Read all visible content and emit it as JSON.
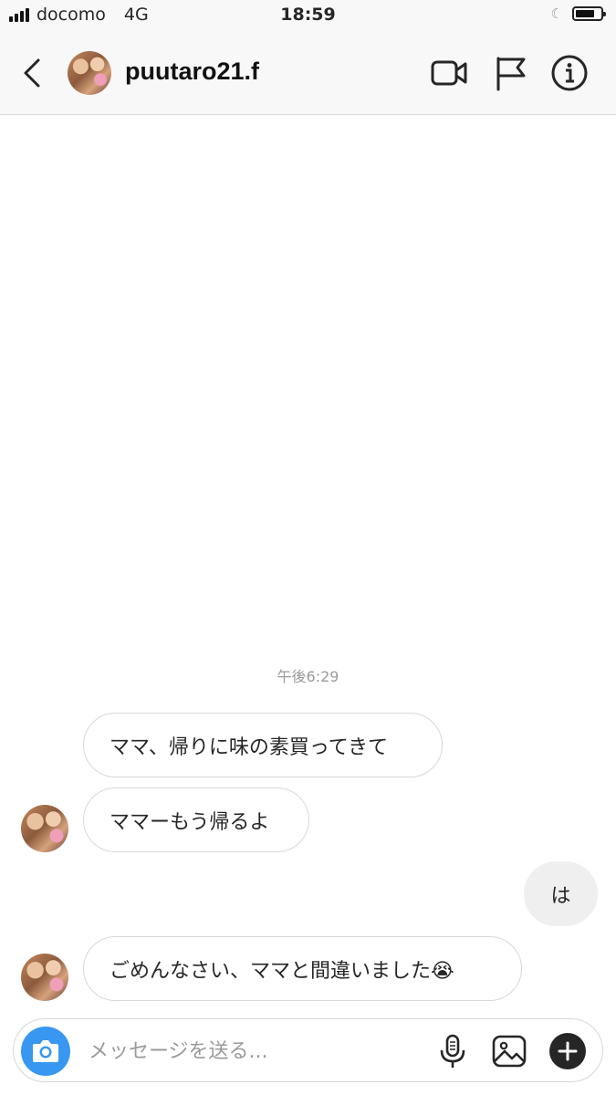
{
  "status_bar": {
    "carrier": "docomo",
    "network": "4G",
    "time": "18:59"
  },
  "header": {
    "username": "puutaro21.f",
    "icons": [
      "back-chevron-icon",
      "video-call-icon",
      "flag-icon",
      "info-icon"
    ]
  },
  "conversation": {
    "timestamp": "午後6:29",
    "messages": [
      {
        "sender": "other",
        "text": "ママ、帰りに味の素買ってきて",
        "show_avatar": false
      },
      {
        "sender": "other",
        "text": "ママーもう帰るよ",
        "show_avatar": true
      },
      {
        "sender": "me",
        "text": "は",
        "show_avatar": false
      },
      {
        "sender": "other",
        "text": "ごめんなさい、ママと間違いました😭",
        "show_avatar": true
      }
    ]
  },
  "composer": {
    "placeholder": "メッセージを送る...",
    "icons": [
      "camera-icon",
      "microphone-icon",
      "gallery-icon",
      "plus-icon"
    ]
  },
  "colors": {
    "accent": "#3897f0",
    "bubble_border": "#d8d8d8",
    "my_bubble": "#efefef",
    "header_bg": "#f8f8f8",
    "timestamp_text": "#9a9a9a"
  }
}
